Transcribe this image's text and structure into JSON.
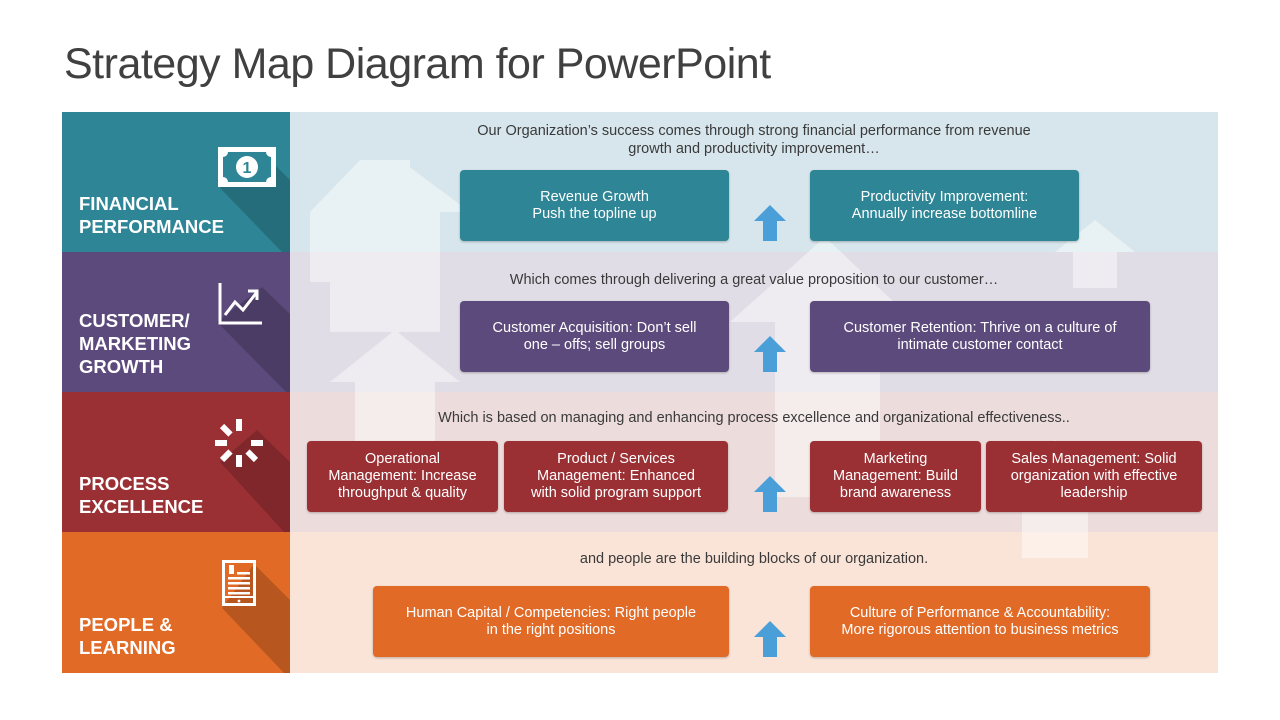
{
  "title": "Strategy Map Diagram for PowerPoint",
  "colors": {
    "financial": "#2e8595",
    "customer": "#5c4a7c",
    "process": "#9b3034",
    "people": "#e16a26",
    "arrow": "#4a9fd8"
  },
  "perspectives": [
    {
      "label": "FINANCIAL PERFORMANCE",
      "label_lines": [
        "FINANCIAL",
        "PERFORMANCE"
      ],
      "icon": "money-bill-icon",
      "lead": "Our Organization’s success comes through strong financial performance from revenue growth and productivity improvement…",
      "lead_lines": [
        "Our Organization’s success comes through strong financial performance from revenue",
        "growth and productivity improvement…"
      ],
      "boxes": [
        {
          "lines": [
            "Revenue Growth",
            "Push the topline up"
          ]
        },
        {
          "lines": [
            "Productivity Improvement:",
            "Annually increase bottomline"
          ]
        }
      ]
    },
    {
      "label": "CUSTOMER/ MARKETING GROWTH",
      "label_lines": [
        "CUSTOMER/",
        "MARKETING",
        "GROWTH"
      ],
      "icon": "line-chart-icon",
      "lead": "Which comes through delivering a great value proposition to our customer…",
      "lead_lines": [
        "Which comes through delivering a great value proposition to our customer…"
      ],
      "boxes": [
        {
          "lines": [
            "Customer Acquisition: Don’t sell",
            "one – offs; sell groups"
          ]
        },
        {
          "lines": [
            "Customer Retention: Thrive on a culture of",
            "intimate customer contact"
          ]
        }
      ]
    },
    {
      "label": "PROCESS EXCELLENCE",
      "label_lines": [
        "PROCESS",
        "EXCELLENCE"
      ],
      "icon": "loading-spinner-icon",
      "lead": "Which is based on managing and enhancing process excellence and organizational effectiveness..",
      "lead_lines": [
        "Which is based on managing and enhancing process excellence and organizational effectiveness.."
      ],
      "boxes": [
        {
          "lines": [
            "Operational",
            "Management: Increase",
            "throughput & quality"
          ]
        },
        {
          "lines": [
            "Product / Services",
            "Management: Enhanced",
            "with solid program support"
          ]
        },
        {
          "lines": [
            "Marketing",
            "Management: Build",
            "brand awareness"
          ]
        },
        {
          "lines": [
            "Sales Management: Solid",
            "organization with effective",
            "leadership"
          ]
        }
      ]
    },
    {
      "label": "PEOPLE & LEARNING",
      "label_lines": [
        "PEOPLE &",
        "LEARNING"
      ],
      "icon": "ebook-reader-icon",
      "lead": "and people are the building blocks of our organization.",
      "lead_lines": [
        "and people are the building blocks of our organization."
      ],
      "boxes": [
        {
          "lines": [
            "Human Capital / Competencies: Right people",
            "in the right positions"
          ]
        },
        {
          "lines": [
            "Culture of Performance & Accountability:",
            "More rigorous attention to business metrics"
          ]
        }
      ]
    }
  ]
}
